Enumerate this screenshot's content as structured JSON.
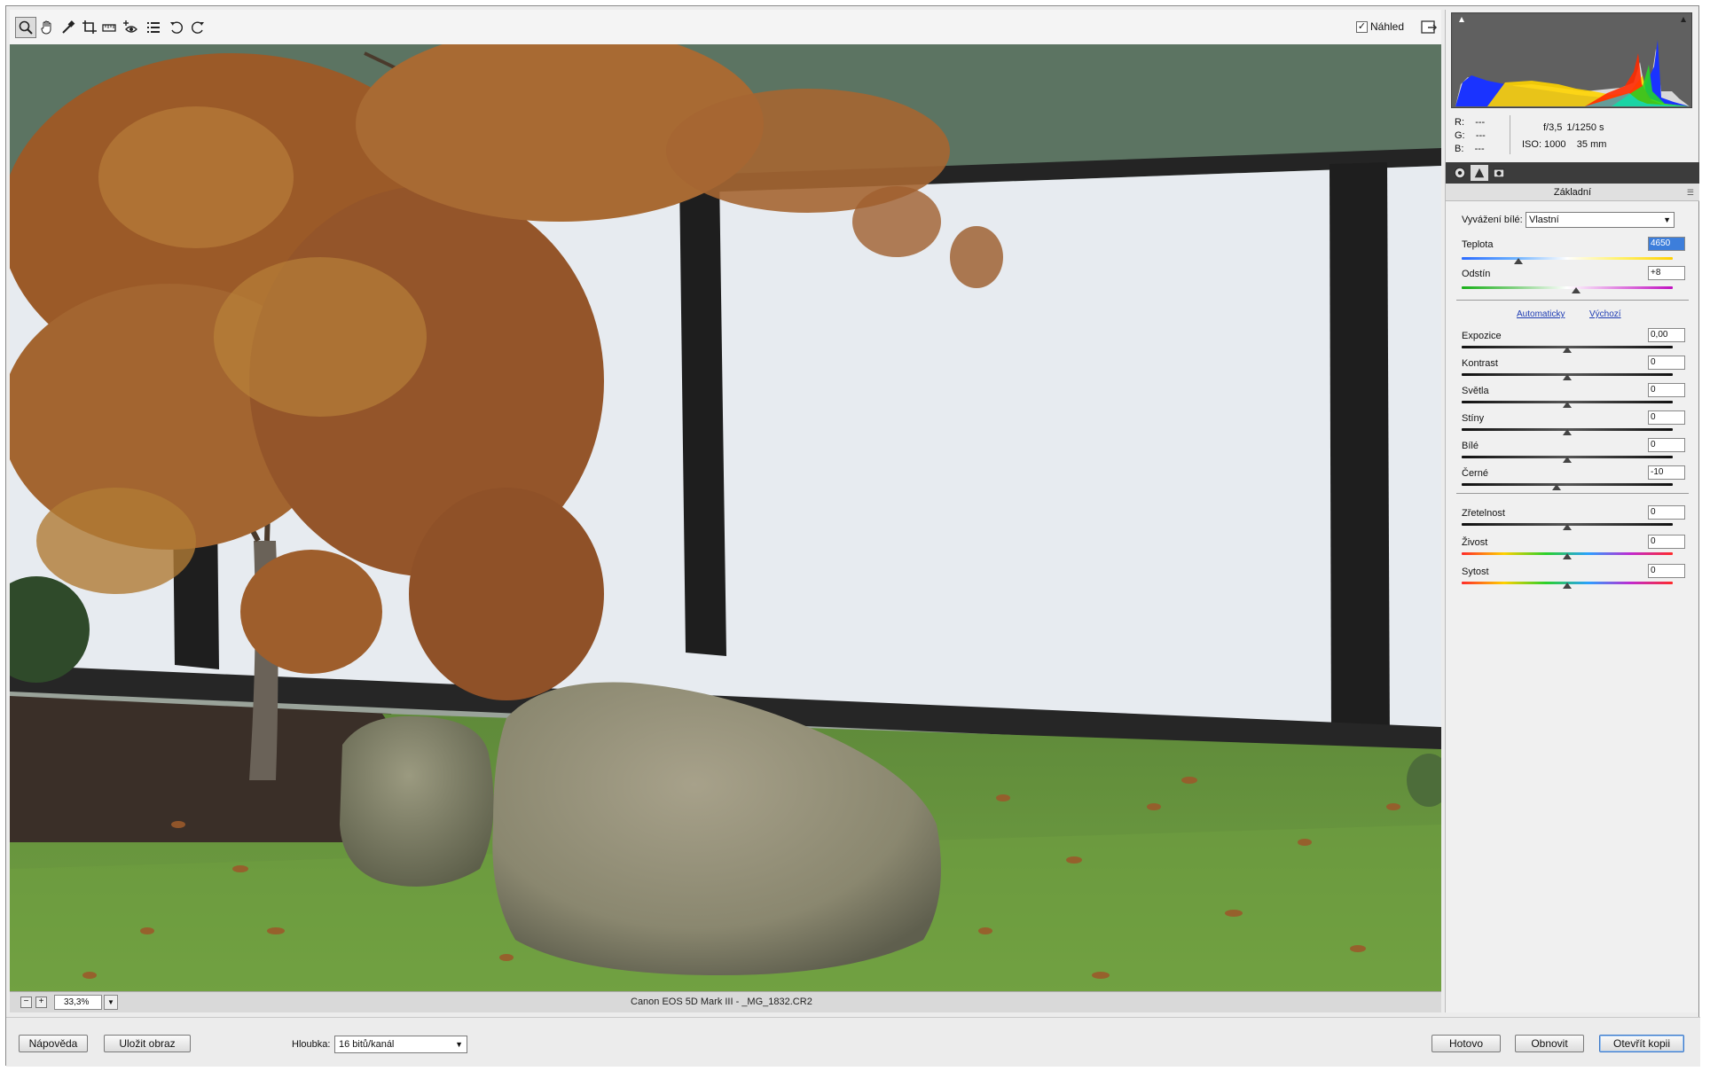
{
  "toolbar": {
    "tools": [
      "zoom-icon",
      "hand-icon",
      "white-balance-icon",
      "crop-icon",
      "straighten-icon",
      "red-eye-icon",
      "preferences-icon",
      "rotate-left-icon",
      "rotate-right-icon"
    ],
    "preview_label": "Náhled",
    "preview_checked": true
  },
  "status": {
    "zoom": "33,3%",
    "file_info": "Canon EOS 5D Mark III  -  _MG_1832.CR2"
  },
  "info": {
    "r_label": "R:",
    "r_value": "---",
    "g_label": "G:",
    "g_value": "---",
    "b_label": "B:",
    "b_value": "---",
    "aperture": "f/3,5",
    "shutter": "1/1250 s",
    "iso": "ISO: 1000",
    "focal": "35 mm"
  },
  "panel": {
    "title": "Základní",
    "white_balance_label": "Vyvážení bílé:",
    "white_balance_value": "Vlastní",
    "temperature": {
      "label": "Teplota",
      "value": "4650",
      "position": 0.27
    },
    "tint": {
      "label": "Odstín",
      "value": "+8",
      "position": 0.54
    },
    "auto_link": "Automaticky",
    "default_link": "Výchozí",
    "tone_sliders": [
      {
        "label": "Expozice",
        "value": "0,00",
        "position": 0.5
      },
      {
        "label": "Kontrast",
        "value": "0",
        "position": 0.5
      },
      {
        "label": "Světla",
        "value": "0",
        "position": 0.5
      },
      {
        "label": "Stíny",
        "value": "0",
        "position": 0.5
      },
      {
        "label": "Bílé",
        "value": "0",
        "position": 0.5
      },
      {
        "label": "Černé",
        "value": "-10",
        "position": 0.45
      }
    ],
    "presence_sliders": [
      {
        "label": "Zřetelnost",
        "value": "0",
        "position": 0.5
      },
      {
        "label": "Živost",
        "value": "0",
        "position": 0.5
      },
      {
        "label": "Sytost",
        "value": "0",
        "position": 0.5
      }
    ]
  },
  "bottom": {
    "help_label": "Nápověda",
    "save_label": "Uložit obraz",
    "depth_label": "Hloubka:",
    "depth_value": "16 bitů/kanál",
    "done_label": "Hotovo",
    "reset_label": "Obnovit",
    "open_copy_label": "Otevřít kopii"
  }
}
